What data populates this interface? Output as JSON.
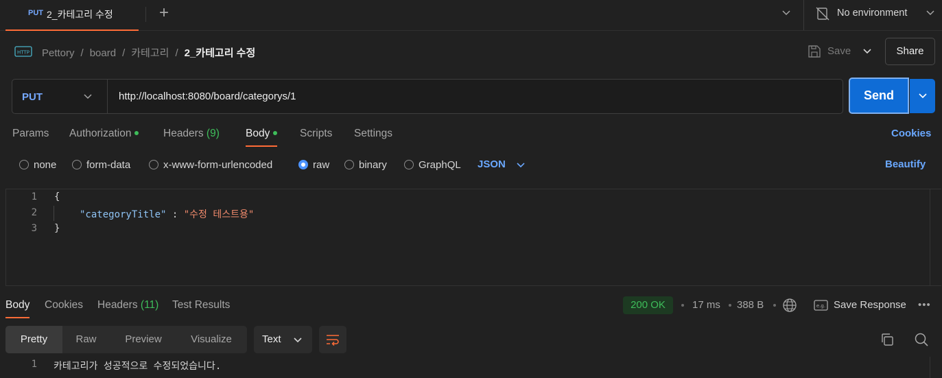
{
  "tab": {
    "method": "PUT",
    "name": "2_카테고리 수정"
  },
  "environment": {
    "label": "No environment"
  },
  "breadcrumb": {
    "items": [
      "Pettory",
      "board",
      "카테고리"
    ],
    "current": "2_카테고리 수정"
  },
  "header_actions": {
    "save": "Save",
    "share": "Share"
  },
  "request": {
    "method": "PUT",
    "url": "http://localhost:8080/board/categorys/1",
    "send": "Send"
  },
  "request_tabs": {
    "params": "Params",
    "authorization": "Authorization",
    "headers": "Headers",
    "headers_count": "(9)",
    "body": "Body",
    "scripts": "Scripts",
    "settings": "Settings",
    "cookies": "Cookies"
  },
  "body_types": {
    "none": "none",
    "form_data": "form-data",
    "urlencoded": "x-www-form-urlencoded",
    "raw": "raw",
    "binary": "binary",
    "graphql": "GraphQL",
    "format": "JSON",
    "beautify": "Beautify",
    "selected": "raw"
  },
  "editor": {
    "line_numbers": [
      "1",
      "2",
      "3"
    ],
    "open_brace": "{",
    "key": "\"categoryTitle\"",
    "colon": " : ",
    "value": "\"수정 테스트용\"",
    "close_brace": "}"
  },
  "response": {
    "tabs": {
      "body": "Body",
      "cookies": "Cookies",
      "headers": "Headers",
      "headers_count": "(11)",
      "test_results": "Test Results"
    },
    "status": "200 OK",
    "time": "17 ms",
    "size": "388 B",
    "save_response": "Save Response",
    "more": "•••",
    "views": {
      "pretty": "Pretty",
      "raw": "Raw",
      "preview": "Preview",
      "visualize": "Visualize"
    },
    "format": "Text",
    "line_number": "1",
    "body_text": "카테고리가 성공적으로 수정되었습니다."
  },
  "colors": {
    "accent_orange": "#ff6c37",
    "send_blue": "#0f6cd6",
    "link_blue": "#6aa8ff",
    "success_green": "#3ebd5a",
    "method_put": "#76a9ff"
  }
}
